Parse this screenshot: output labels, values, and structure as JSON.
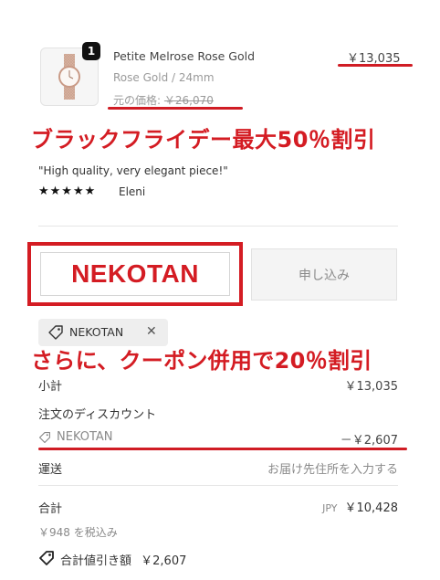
{
  "product": {
    "quantity": "1",
    "name": "Petite Melrose Rose Gold",
    "price": "￥13,035",
    "variant": "Rose Gold / 24mm",
    "original_price_label": "元の価格:",
    "original_price": "￥26,070"
  },
  "promo": {
    "black_friday": "ブラックフライデー最大50％割引",
    "coupon": "さらに、クーポン併用で20％割引"
  },
  "review": {
    "text": "\"High quality, very elegant piece!\"",
    "stars": "★★★★★",
    "rating": 5,
    "reviewer": "Eleni"
  },
  "discount": {
    "input_value": "NEKOTAN",
    "apply_label": "申し込み",
    "applied_code": "NEKOTAN"
  },
  "summary": {
    "subtotal_label": "小計",
    "subtotal_value": "￥13,035",
    "order_discount_label": "注文のディスカウント",
    "discount_code": "NEKOTAN",
    "discount_value": "－￥2,607",
    "shipping_label": "運送",
    "shipping_value": "お届け先住所を入力する",
    "total_label": "合計",
    "currency": "JPY",
    "total_value": "￥10,428",
    "tax_note": "￥948 を税込み",
    "total_savings_label": "合計値引き額",
    "total_savings_value": "￥2,607"
  },
  "colors": {
    "accent_red": "#d41c23",
    "text_dark": "#333333",
    "text_muted": "#8a8a8a"
  }
}
